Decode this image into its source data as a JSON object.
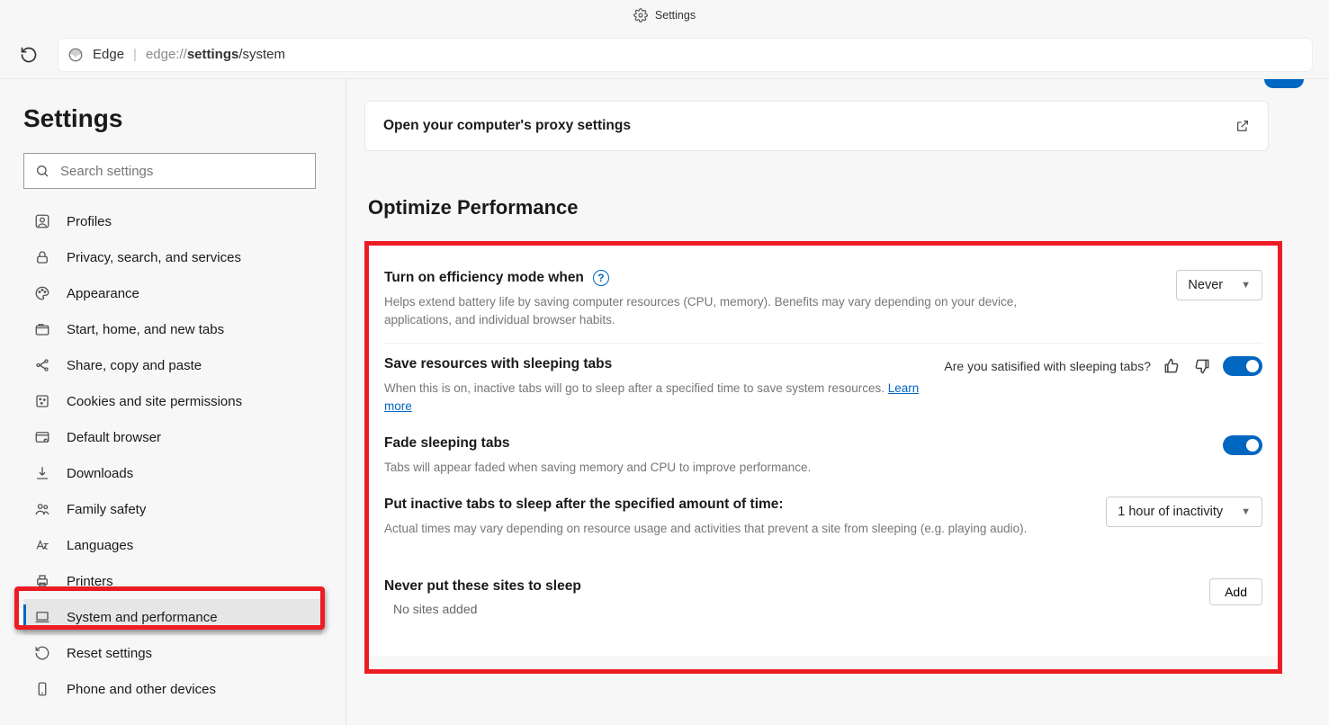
{
  "tab": {
    "title": "Settings"
  },
  "addressbar": {
    "app": "Edge",
    "prefix": "edge://",
    "page": "settings",
    "suffix": "/system"
  },
  "sidebar": {
    "title": "Settings",
    "search_placeholder": "Search settings",
    "items": [
      {
        "label": "Profiles"
      },
      {
        "label": "Privacy, search, and services"
      },
      {
        "label": "Appearance"
      },
      {
        "label": "Start, home, and new tabs"
      },
      {
        "label": "Share, copy and paste"
      },
      {
        "label": "Cookies and site permissions"
      },
      {
        "label": "Default browser"
      },
      {
        "label": "Downloads"
      },
      {
        "label": "Family safety"
      },
      {
        "label": "Languages"
      },
      {
        "label": "Printers"
      },
      {
        "label": "System and performance"
      },
      {
        "label": "Reset settings"
      },
      {
        "label": "Phone and other devices"
      }
    ]
  },
  "proxy": {
    "title": "Open your computer's proxy settings"
  },
  "section": {
    "title": "Optimize Performance"
  },
  "settings": {
    "efficiency": {
      "title": "Turn on efficiency mode when",
      "desc": "Helps extend battery life by saving computer resources (CPU, memory). Benefits may vary depending on your device, applications, and individual browser habits.",
      "value": "Never"
    },
    "sleeping_tabs": {
      "title": "Save resources with sleeping tabs",
      "desc_prefix": "When this is on, inactive tabs will go to sleep after a specified time to save system resources. ",
      "learn_more": "Learn more",
      "feedback_q": "Are you satisified with sleeping tabs?"
    },
    "fade": {
      "title": "Fade sleeping tabs",
      "desc": "Tabs will appear faded when saving memory and CPU to improve performance."
    },
    "inactive": {
      "title": "Put inactive tabs to sleep after the specified amount of time:",
      "desc": "Actual times may vary depending on resource usage and activities that prevent a site from sleeping (e.g. playing audio).",
      "value": "1 hour of inactivity"
    },
    "never_sleep": {
      "title": "Never put these sites to sleep",
      "add": "Add",
      "empty": "No sites added"
    }
  }
}
